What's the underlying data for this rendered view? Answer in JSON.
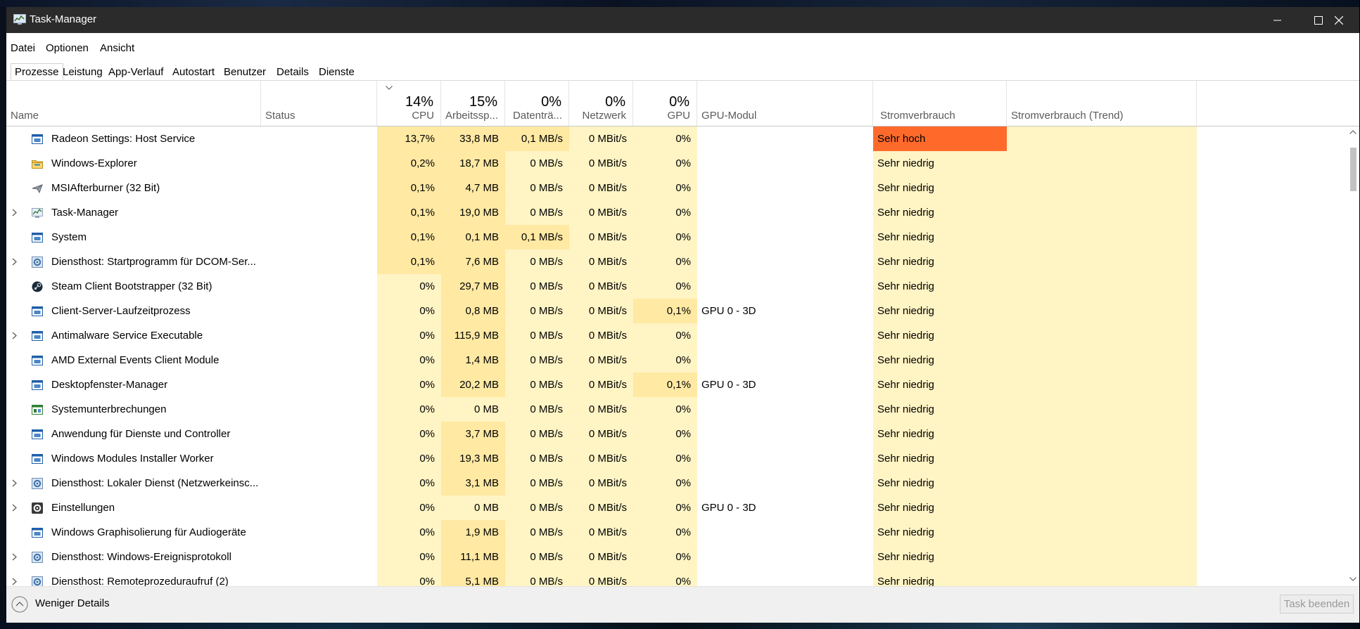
{
  "window": {
    "title": "Task-Manager"
  },
  "menu": [
    "Datei",
    "Optionen",
    "Ansicht"
  ],
  "tabs": [
    "Prozesse",
    "Leistung",
    "App-Verlauf",
    "Autostart",
    "Benutzer",
    "Details",
    "Dienste"
  ],
  "active_tab": "Prozesse",
  "columns": {
    "name": "Name",
    "status": "Status",
    "cpu": {
      "label": "CPU",
      "pct": "14%"
    },
    "mem": {
      "label": "Arbeitssp...",
      "pct": "15%"
    },
    "disk": {
      "label": "Datenträ...",
      "pct": "0%"
    },
    "net": {
      "label": "Netzwerk",
      "pct": "0%"
    },
    "gpu": {
      "label": "GPU",
      "pct": "0%"
    },
    "gpuengine": "GPU-Modul",
    "power": "Stromverbrauch",
    "powertrend": "Stromverbrauch (Trend)"
  },
  "colors": {
    "heat_1": "#fff4c4",
    "heat_2": "#ffe9a3",
    "power_very_high": "#ff6a2b",
    "power_cell": "#fff4c4",
    "leaf_green": "#2e7d32"
  },
  "rows": [
    {
      "name": "Radeon Settings: Host Service",
      "icon": "app-window-icon",
      "expand": false,
      "status": "",
      "eco": false,
      "cpu": "13,7%",
      "mem": "33,8 MB",
      "disk": "0,1 MB/s",
      "net": "0 MBit/s",
      "gpu": "0%",
      "engine": "",
      "power": "Sehr hoch",
      "power_level": "high",
      "cpu_heat": 2,
      "mem_heat": 2,
      "disk_heat": 2,
      "gpu_heat": 1
    },
    {
      "name": "Windows-Explorer",
      "icon": "folder-icon",
      "expand": false,
      "status": "",
      "eco": false,
      "cpu": "0,2%",
      "mem": "18,7 MB",
      "disk": "0 MB/s",
      "net": "0 MBit/s",
      "gpu": "0%",
      "engine": "",
      "power": "Sehr niedrig",
      "power_level": "low",
      "cpu_heat": 2,
      "mem_heat": 2,
      "disk_heat": 1,
      "gpu_heat": 1
    },
    {
      "name": "MSIAfterburner (32 Bit)",
      "icon": "airplane-icon",
      "expand": false,
      "status": "",
      "eco": false,
      "cpu": "0,1%",
      "mem": "4,7 MB",
      "disk": "0 MB/s",
      "net": "0 MBit/s",
      "gpu": "0%",
      "engine": "",
      "power": "Sehr niedrig",
      "power_level": "low",
      "cpu_heat": 2,
      "mem_heat": 2,
      "disk_heat": 1,
      "gpu_heat": 1
    },
    {
      "name": "Task-Manager",
      "icon": "task-manager-icon",
      "expand": true,
      "status": "",
      "eco": false,
      "cpu": "0,1%",
      "mem": "19,0 MB",
      "disk": "0 MB/s",
      "net": "0 MBit/s",
      "gpu": "0%",
      "engine": "",
      "power": "Sehr niedrig",
      "power_level": "low",
      "cpu_heat": 2,
      "mem_heat": 2,
      "disk_heat": 1,
      "gpu_heat": 1
    },
    {
      "name": "System",
      "icon": "app-window-icon",
      "expand": false,
      "status": "",
      "eco": false,
      "cpu": "0,1%",
      "mem": "0,1 MB",
      "disk": "0,1 MB/s",
      "net": "0 MBit/s",
      "gpu": "0%",
      "engine": "",
      "power": "Sehr niedrig",
      "power_level": "low",
      "cpu_heat": 2,
      "mem_heat": 2,
      "disk_heat": 2,
      "gpu_heat": 1
    },
    {
      "name": "Diensthost: Startprogramm für DCOM-Ser...",
      "icon": "gear-service-icon",
      "expand": true,
      "status": "",
      "eco": false,
      "cpu": "0,1%",
      "mem": "7,6 MB",
      "disk": "0 MB/s",
      "net": "0 MBit/s",
      "gpu": "0%",
      "engine": "",
      "power": "Sehr niedrig",
      "power_level": "low",
      "cpu_heat": 2,
      "mem_heat": 2,
      "disk_heat": 1,
      "gpu_heat": 1
    },
    {
      "name": "Steam Client Bootstrapper (32 Bit)",
      "icon": "steam-icon",
      "expand": false,
      "status": "",
      "eco": false,
      "cpu": "0%",
      "mem": "29,7 MB",
      "disk": "0 MB/s",
      "net": "0 MBit/s",
      "gpu": "0%",
      "engine": "",
      "power": "Sehr niedrig",
      "power_level": "low",
      "cpu_heat": 1,
      "mem_heat": 2,
      "disk_heat": 1,
      "gpu_heat": 1
    },
    {
      "name": "Client-Server-Laufzeitprozess",
      "icon": "app-window-icon",
      "expand": false,
      "status": "",
      "eco": false,
      "cpu": "0%",
      "mem": "0,8 MB",
      "disk": "0 MB/s",
      "net": "0 MBit/s",
      "gpu": "0,1%",
      "engine": "GPU 0 - 3D",
      "power": "Sehr niedrig",
      "power_level": "low",
      "cpu_heat": 1,
      "mem_heat": 2,
      "disk_heat": 1,
      "gpu_heat": 2
    },
    {
      "name": "Antimalware Service Executable",
      "icon": "app-window-icon",
      "expand": true,
      "status": "",
      "eco": false,
      "cpu": "0%",
      "mem": "115,9 MB",
      "disk": "0 MB/s",
      "net": "0 MBit/s",
      "gpu": "0%",
      "engine": "",
      "power": "Sehr niedrig",
      "power_level": "low",
      "cpu_heat": 1,
      "mem_heat": 2,
      "disk_heat": 1,
      "gpu_heat": 1
    },
    {
      "name": "AMD External Events Client Module",
      "icon": "app-window-icon",
      "expand": false,
      "status": "",
      "eco": false,
      "cpu": "0%",
      "mem": "1,4 MB",
      "disk": "0 MB/s",
      "net": "0 MBit/s",
      "gpu": "0%",
      "engine": "",
      "power": "Sehr niedrig",
      "power_level": "low",
      "cpu_heat": 1,
      "mem_heat": 2,
      "disk_heat": 1,
      "gpu_heat": 1
    },
    {
      "name": "Desktopfenster-Manager",
      "icon": "app-window-icon",
      "expand": false,
      "status": "",
      "eco": false,
      "cpu": "0%",
      "mem": "20,2 MB",
      "disk": "0 MB/s",
      "net": "0 MBit/s",
      "gpu": "0,1%",
      "engine": "GPU 0 - 3D",
      "power": "Sehr niedrig",
      "power_level": "low",
      "cpu_heat": 1,
      "mem_heat": 2,
      "disk_heat": 1,
      "gpu_heat": 2
    },
    {
      "name": "Systemunterbrechungen",
      "icon": "interrupts-icon",
      "expand": false,
      "status": "",
      "eco": false,
      "cpu": "0%",
      "mem": "0 MB",
      "disk": "0 MB/s",
      "net": "0 MBit/s",
      "gpu": "0%",
      "engine": "",
      "power": "Sehr niedrig",
      "power_level": "low",
      "cpu_heat": 1,
      "mem_heat": 1,
      "disk_heat": 1,
      "gpu_heat": 1
    },
    {
      "name": "Anwendung für Dienste und Controller",
      "icon": "app-window-icon",
      "expand": false,
      "status": "",
      "eco": false,
      "cpu": "0%",
      "mem": "3,7 MB",
      "disk": "0 MB/s",
      "net": "0 MBit/s",
      "gpu": "0%",
      "engine": "",
      "power": "Sehr niedrig",
      "power_level": "low",
      "cpu_heat": 1,
      "mem_heat": 2,
      "disk_heat": 1,
      "gpu_heat": 1
    },
    {
      "name": "Windows Modules Installer Worker",
      "icon": "app-window-icon",
      "expand": false,
      "status": "",
      "eco": false,
      "cpu": "0%",
      "mem": "19,3 MB",
      "disk": "0 MB/s",
      "net": "0 MBit/s",
      "gpu": "0%",
      "engine": "",
      "power": "Sehr niedrig",
      "power_level": "low",
      "cpu_heat": 1,
      "mem_heat": 2,
      "disk_heat": 1,
      "gpu_heat": 1
    },
    {
      "name": "Diensthost: Lokaler Dienst (Netzwerkeinsc...",
      "icon": "gear-service-icon",
      "expand": true,
      "status": "",
      "eco": false,
      "cpu": "0%",
      "mem": "3,1 MB",
      "disk": "0 MB/s",
      "net": "0 MBit/s",
      "gpu": "0%",
      "engine": "",
      "power": "Sehr niedrig",
      "power_level": "low",
      "cpu_heat": 1,
      "mem_heat": 2,
      "disk_heat": 1,
      "gpu_heat": 1
    },
    {
      "name": "Einstellungen",
      "icon": "settings-gear-icon",
      "expand": true,
      "status": "",
      "eco": true,
      "cpu": "0%",
      "mem": "0 MB",
      "disk": "0 MB/s",
      "net": "0 MBit/s",
      "gpu": "0%",
      "engine": "GPU 0 - 3D",
      "power": "Sehr niedrig",
      "power_level": "low",
      "cpu_heat": 1,
      "mem_heat": 1,
      "disk_heat": 1,
      "gpu_heat": 1
    },
    {
      "name": "Windows Graphisolierung für Audiogeräte",
      "icon": "app-window-icon",
      "expand": false,
      "status": "",
      "eco": false,
      "cpu": "0%",
      "mem": "1,9 MB",
      "disk": "0 MB/s",
      "net": "0 MBit/s",
      "gpu": "0%",
      "engine": "",
      "power": "Sehr niedrig",
      "power_level": "low",
      "cpu_heat": 1,
      "mem_heat": 2,
      "disk_heat": 1,
      "gpu_heat": 1
    },
    {
      "name": "Diensthost: Windows-Ereignisprotokoll",
      "icon": "gear-service-icon",
      "expand": true,
      "status": "",
      "eco": false,
      "cpu": "0%",
      "mem": "11,1 MB",
      "disk": "0 MB/s",
      "net": "0 MBit/s",
      "gpu": "0%",
      "engine": "",
      "power": "Sehr niedrig",
      "power_level": "low",
      "cpu_heat": 1,
      "mem_heat": 2,
      "disk_heat": 1,
      "gpu_heat": 1
    },
    {
      "name": "Diensthost: Remoteprozeduraufruf (2)",
      "icon": "gear-service-icon",
      "expand": true,
      "status": "",
      "eco": false,
      "cpu": "0%",
      "mem": "5,1 MB",
      "disk": "0 MB/s",
      "net": "0 MBit/s",
      "gpu": "0%",
      "engine": "",
      "power": "Sehr niedrig",
      "power_level": "low",
      "cpu_heat": 1,
      "mem_heat": 2,
      "disk_heat": 1,
      "gpu_heat": 1
    }
  ],
  "footer": {
    "fewer_details": "Weniger Details",
    "end_task": "Task beenden"
  }
}
